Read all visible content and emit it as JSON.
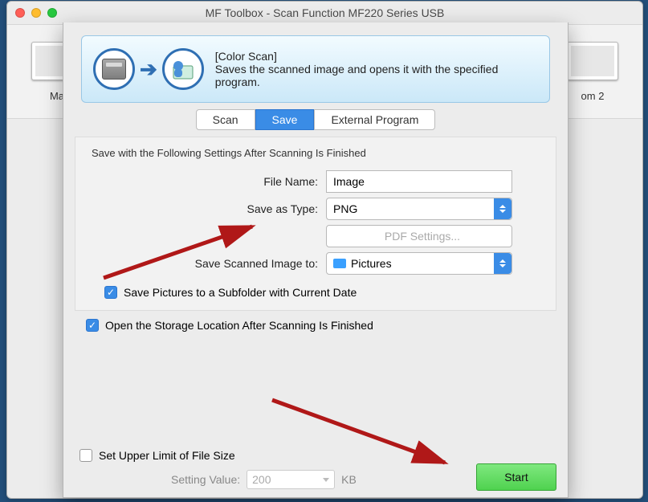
{
  "window": {
    "title": "MF Toolbox - Scan Function MF220 Series USB"
  },
  "toolbar": {
    "item_left_label": "Ma",
    "item_right_label": "om 2"
  },
  "banner": {
    "heading": "[Color Scan]",
    "body": "Saves the scanned image and opens it with the specified program."
  },
  "tabs": {
    "scan": "Scan",
    "save": "Save",
    "external": "External Program"
  },
  "save": {
    "section_title": "Save with the Following Settings After Scanning Is Finished",
    "file_name_label": "File Name:",
    "file_name_value": "Image",
    "save_as_type_label": "Save as Type:",
    "save_as_type_value": "PNG",
    "pdf_settings_label": "PDF Settings...",
    "save_to_label": "Save Scanned Image to:",
    "save_to_value": "Pictures",
    "subfolder_label": "Save Pictures to a Subfolder with Current Date"
  },
  "open_after": {
    "label": "Open the Storage Location After Scanning Is Finished"
  },
  "limit": {
    "label": "Set Upper Limit of File Size",
    "setting_label": "Setting Value:",
    "setting_value": "200",
    "unit": "KB"
  },
  "start": {
    "label": "Start"
  }
}
